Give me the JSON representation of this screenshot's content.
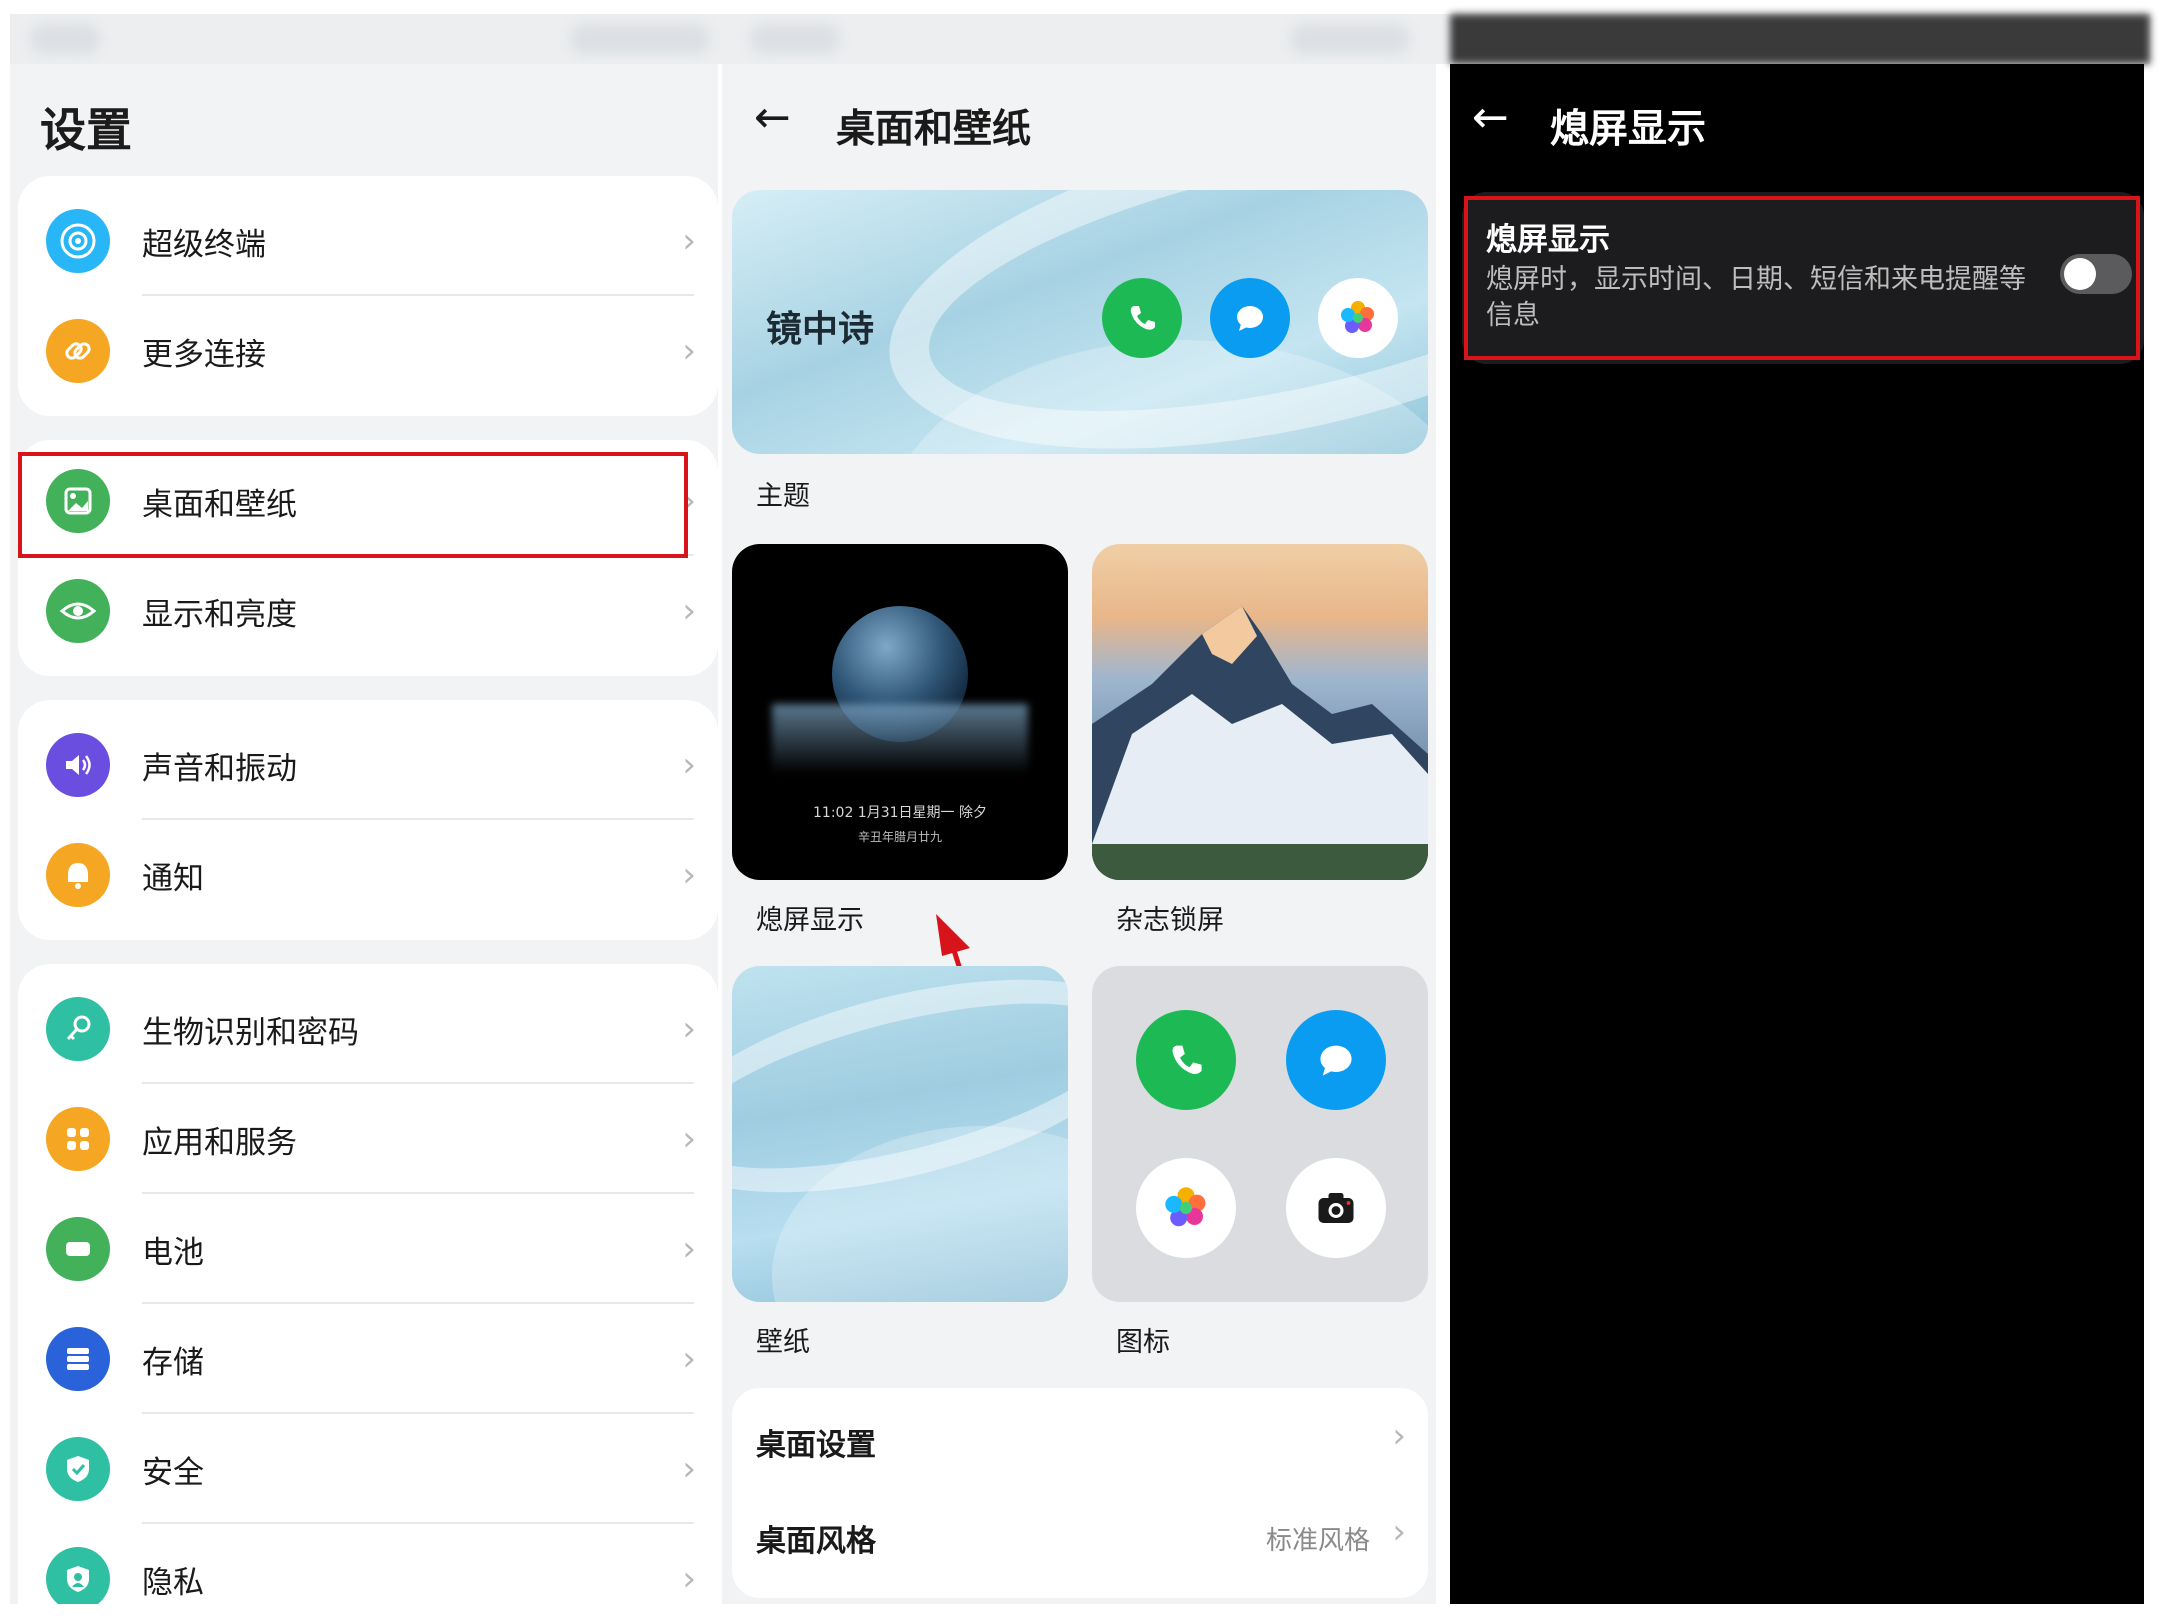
{
  "settings": {
    "title": "设置",
    "items": [
      {
        "label": "超级终端",
        "icon": "super-device-icon",
        "color": "#29b6f6"
      },
      {
        "label": "更多连接",
        "icon": "link-icon",
        "color": "#f5a623"
      },
      {
        "label": "桌面和壁纸",
        "icon": "image-icon",
        "color": "#43b15a"
      },
      {
        "label": "显示和亮度",
        "icon": "eye-icon",
        "color": "#43b15a"
      },
      {
        "label": "声音和振动",
        "icon": "speaker-icon",
        "color": "#6a4ee0"
      },
      {
        "label": "通知",
        "icon": "bell-icon",
        "color": "#f5a623"
      },
      {
        "label": "生物识别和密码",
        "icon": "key-icon",
        "color": "#2fbfa3"
      },
      {
        "label": "应用和服务",
        "icon": "apps-icon",
        "color": "#f5a623"
      },
      {
        "label": "电池",
        "icon": "battery-icon",
        "color": "#43b15a"
      },
      {
        "label": "存储",
        "icon": "storage-icon",
        "color": "#2962d9"
      },
      {
        "label": "安全",
        "icon": "shield-check-icon",
        "color": "#2fbfa3"
      },
      {
        "label": "隐私",
        "icon": "privacy-icon",
        "color": "#2fbfa3"
      }
    ]
  },
  "desktop": {
    "title": "桌面和壁纸",
    "theme_name": "镜中诗",
    "theme_caption": "主题",
    "aod_caption": "熄屏显示",
    "aod_time": "11:02 1月31日星期一 除夕",
    "aod_lunar": "辛丑年腊月廿九",
    "magazine_caption": "杂志锁屏",
    "wallpaper_caption": "壁纸",
    "icons_caption": "图标",
    "desktop_settings_label": "桌面设置",
    "desktop_style_label": "桌面风格",
    "desktop_style_value": "标准风格"
  },
  "aod": {
    "title": "熄屏显示",
    "item_title": "熄屏显示",
    "item_desc": "熄屏时，显示时间、日期、短信和来电提醒等信息",
    "toggle_on": false
  },
  "colors": {
    "highlight_red": "#d8141b",
    "phone_green": "#1db954",
    "message_blue": "#0a9cf0"
  }
}
